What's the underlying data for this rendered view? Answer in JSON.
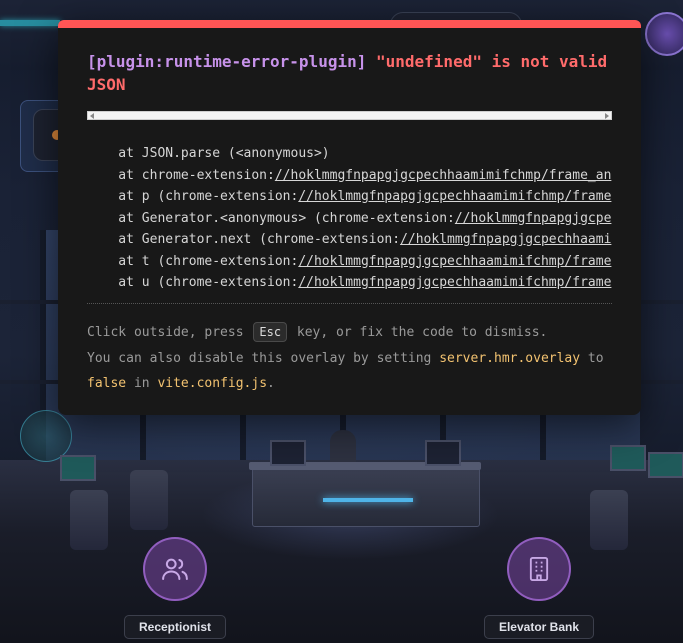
{
  "error_overlay": {
    "plugin": "[plugin:runtime-error-plugin]",
    "message_line1": "\"undefined\" is not valid",
    "message_line2": "JSON",
    "stack": [
      {
        "prefix": "    at JSON.parse (<anonymous>)",
        "link": "",
        "suffix": ""
      },
      {
        "prefix": "    at chrome-extension:",
        "link": "//hoklmmgfnpapgjgcpechhaamimifchmp/frame_an",
        "suffix": ""
      },
      {
        "prefix": "    at p (chrome-extension:",
        "link": "//hoklmmgfnpapgjgcpechhaamimifchmp/frame",
        "suffix": ""
      },
      {
        "prefix": "    at Generator.<anonymous> (chrome-extension:",
        "link": "//hoklmmgfnpapgjgcpe",
        "suffix": ""
      },
      {
        "prefix": "    at Generator.next (chrome-extension:",
        "link": "//hoklmmgfnpapgjgcpechhaami",
        "suffix": ""
      },
      {
        "prefix": "    at t (chrome-extension:",
        "link": "//hoklmmgfnpapgjgcpechhaamimifchmp/frame",
        "suffix": ""
      },
      {
        "prefix": "    at u (chrome-extension:",
        "link": "//hoklmmgfnpapgjgcpechhaamimifchmp/frame",
        "suffix": ""
      }
    ],
    "tip": {
      "part1": "Click outside, press ",
      "key": "Esc",
      "part2": " key, or fix the code to dismiss.",
      "part3": "You can also disable this overlay by setting ",
      "setting": "server.hmr.overlay",
      "part4": " to",
      "value": "false",
      "part5": " in ",
      "file": "vite.config.js",
      "part6": "."
    },
    "colors": {
      "border": "#ff5555",
      "plugin": "#c792ea",
      "message": "#ff6b6b",
      "code": "#f2c270"
    }
  },
  "hotspots": [
    {
      "label": "Receptionist",
      "icon": "users-icon"
    },
    {
      "label": "Elevator Bank",
      "icon": "building-icon"
    }
  ]
}
